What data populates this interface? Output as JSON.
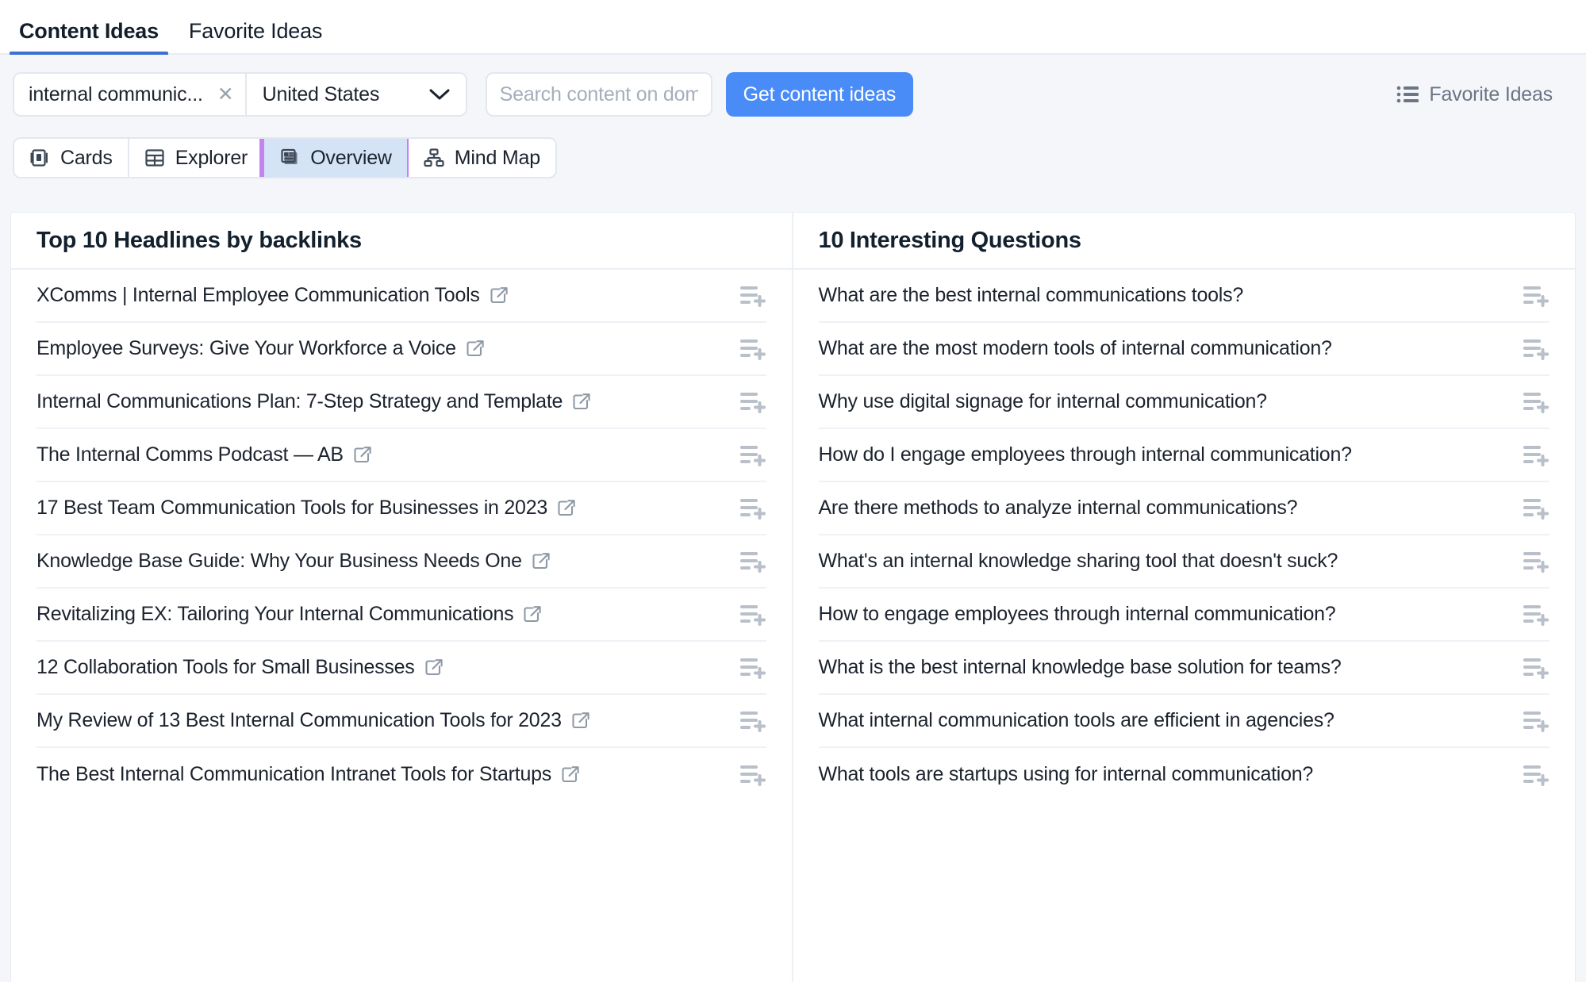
{
  "tabs": [
    {
      "label": "Content Ideas",
      "active": true
    },
    {
      "label": "Favorite Ideas",
      "active": false
    }
  ],
  "toolbar": {
    "keyword_value": "internal communic...",
    "keyword_clear_icon": "close-icon",
    "country_value": "United States",
    "country_chevron_icon": "chevron-down-icon",
    "domain_search_placeholder": "Search content on domain",
    "domain_search_value": "",
    "get_ideas_label": "Get content ideas",
    "favorite_ideas_label": "Favorite Ideas",
    "favorite_ideas_icon": "list-icon",
    "accent_color": "#4a8cf7",
    "highlight_color": "#c583f0"
  },
  "view_modes": [
    {
      "label": "Cards",
      "icon": "cards-icon",
      "selected": false
    },
    {
      "label": "Explorer",
      "icon": "table-icon",
      "selected": false
    },
    {
      "label": "Overview",
      "icon": "overview-icon",
      "selected": true,
      "highlighted": true
    },
    {
      "label": "Mind Map",
      "icon": "mindmap-icon",
      "selected": false
    }
  ],
  "panels": {
    "headlines": {
      "title": "Top 10 Headlines by backlinks",
      "row_action_icon": "add-to-list-icon",
      "link_icon": "external-link-icon",
      "items": [
        "XComms | Internal Employee Communication Tools",
        "Employee Surveys: Give Your Workforce a Voice",
        "Internal Communications Plan: 7-Step Strategy and Template",
        "The Internal Comms Podcast — AB",
        "17 Best Team Communication Tools for Businesses in 2023",
        "Knowledge Base Guide: Why Your Business Needs One",
        "Revitalizing EX: Tailoring Your Internal Communications",
        "12 Collaboration Tools for Small Businesses",
        "My Review of 13 Best Internal Communication Tools for 2023",
        "The Best Internal Communication Intranet Tools for Startups"
      ]
    },
    "questions": {
      "title": "10 Interesting Questions",
      "row_action_icon": "add-to-list-icon",
      "items": [
        "What are the best internal communications tools?",
        "What are the most modern tools of internal communication?",
        "Why use digital signage for internal communication?",
        "How do I engage employees through internal communication?",
        "Are there methods to analyze internal communications?",
        "What's an internal knowledge sharing tool that doesn't suck?",
        "How to engage employees through internal communication?",
        "What is the best internal knowledge base solution for teams?",
        "What internal communication tools are efficient in agencies?",
        "What tools are startups using for internal communication?"
      ]
    }
  }
}
